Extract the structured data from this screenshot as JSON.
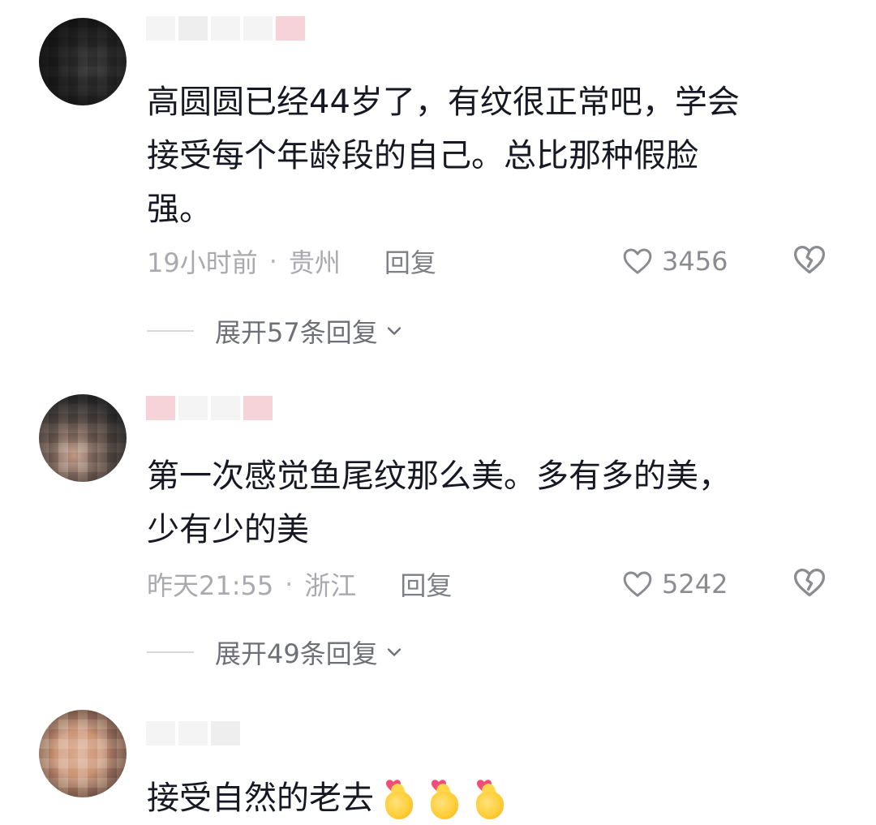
{
  "comments": [
    {
      "text": "高圆圆已经44岁了，有纹很正常吧，学会\n接受每个年龄段的自己。总比那种假脸\n强。",
      "time": "19小时前",
      "dot": "·",
      "location": "贵州",
      "reply_label": "回复",
      "likes": "3456",
      "expand_label": "展开57条回复"
    },
    {
      "text": "第一次感觉鱼尾纹那么美。多有多的美，\n少有少的美",
      "time": "昨天21:55",
      "dot": "·",
      "location": "浙江",
      "reply_label": "回复",
      "likes": "5242",
      "expand_label": "展开49条回复"
    },
    {
      "text": "接受自然的老去",
      "emoji": "heart-hands-emoji",
      "emoji_count": 3
    }
  ],
  "icons": {
    "like": "heart-outline-icon",
    "dislike": "broken-heart-icon",
    "expand": "chevron-down-icon"
  },
  "colors": {
    "text": "#161823",
    "meta": "#a8aab0",
    "reply": "#7e8087",
    "expand": "#6e7077",
    "icon": "#8a8c92"
  }
}
